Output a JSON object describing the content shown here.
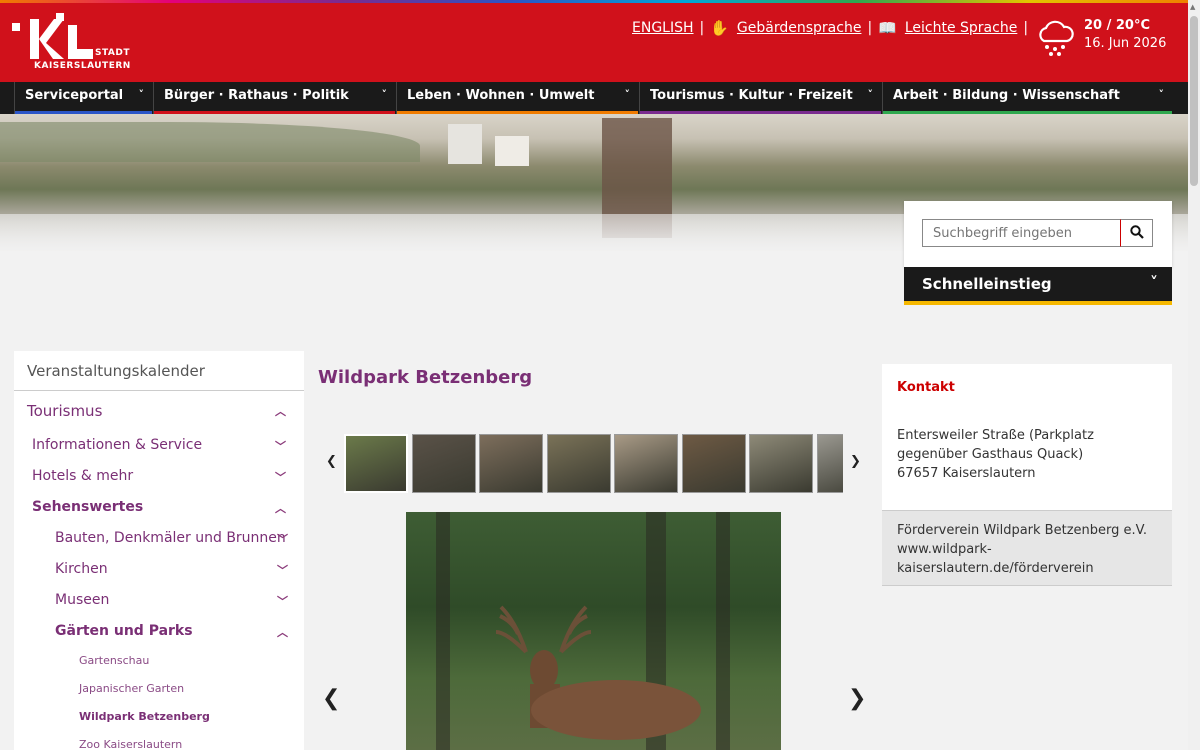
{
  "header": {
    "logo_sub": "KAISERSLAUTERN",
    "logo_stadt": "STADT",
    "links": [
      "ENGLISH",
      "Gebärdensprache",
      "Leichte Sprache"
    ],
    "separator": "|",
    "weather": {
      "temp": "20 / 20°C",
      "date": "16. Jun 2026",
      "icon": "rain-cloud-icon"
    }
  },
  "nav": {
    "items": [
      {
        "label": "Serviceportal",
        "color": "#2b55c7"
      },
      {
        "label": "Bürger · Rathaus · Politik",
        "color": "#d0111b"
      },
      {
        "label": "Leben · Wohnen · Umwelt",
        "color": "#f07c00"
      },
      {
        "label": "Tourismus · Kultur · Freizeit",
        "color": "#7a2b8f"
      },
      {
        "label": "Arbeit · Bildung · Wissenschaft",
        "color": "#2fa84f"
      }
    ],
    "chev": "˅"
  },
  "search": {
    "placeholder": "Suchbegriff eingeben"
  },
  "schnell": {
    "label": "Schnelleinstieg"
  },
  "sidebar": {
    "head": "Veranstaltungskalender",
    "items": [
      {
        "label": "Tourismus",
        "level": 0,
        "state": "open"
      },
      {
        "label": "Informationen & Service",
        "level": 1,
        "state": "closed"
      },
      {
        "label": "Hotels & mehr",
        "level": 1,
        "state": "closed"
      },
      {
        "label": "Sehenswertes",
        "level": 1,
        "state": "open"
      },
      {
        "label": "Bauten, Denkmäler und Brunnen",
        "level": 2,
        "state": "closed"
      },
      {
        "label": "Kirchen",
        "level": 2,
        "state": "closed"
      },
      {
        "label": "Museen",
        "level": 2,
        "state": "closed"
      },
      {
        "label": "Gärten und Parks",
        "level": 2,
        "state": "open"
      },
      {
        "label": "Gartenschau",
        "level": 3,
        "state": "none"
      },
      {
        "label": "Japanischer Garten",
        "level": 3,
        "state": "none"
      },
      {
        "label": "Wildpark Betzenberg",
        "level": 3,
        "state": "active"
      },
      {
        "label": "Zoo Kaiserslautern",
        "level": 3,
        "state": "none"
      }
    ]
  },
  "main": {
    "title": "Wildpark Betzenberg",
    "thumb_colors": [
      "#6b7a4a",
      "#5a5248",
      "#7d6e5c",
      "#7a7258",
      "#a89a86",
      "#6e5a44",
      "#8e8a78",
      "#9a9890"
    ]
  },
  "contact": {
    "heading": "Kontakt",
    "address": [
      "Entersweiler Straße (Parkplatz gegenüber Gasthaus Quack)",
      "67657 Kaiserslautern"
    ],
    "verein": [
      "Förderverein Wildpark Betzenberg e.V.",
      "www.wildpark-kaiserslautern.de/förderverein"
    ]
  }
}
